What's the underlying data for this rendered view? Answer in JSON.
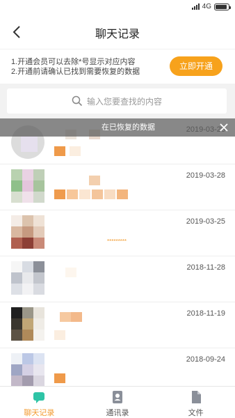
{
  "status_bar": {
    "network": "4G",
    "battery_level": 0.9
  },
  "header": {
    "title": "聊天记录",
    "back_icon": "chevron-left-icon"
  },
  "notice": {
    "line1": "1.开通会员可以去除*号显示对应内容",
    "line2": "2.开通前请确认已找到需要恢复的数据",
    "vip_button": "立即开通"
  },
  "search": {
    "placeholder": "输入您要查找的内容",
    "icon": "search-icon"
  },
  "toast": {
    "text": "在已恢复的数据",
    "close_icon": "close-icon"
  },
  "colors": {
    "accent": "#f7a21c",
    "masked_text": "#f29b2f"
  },
  "chats": [
    {
      "date": "2019-03-28",
      "masked": ""
    },
    {
      "date": "2019-03-28",
      "masked": ""
    },
    {
      "date": "2019-03-25",
      "masked": "*********"
    },
    {
      "date": "2018-11-28",
      "masked": ""
    },
    {
      "date": "2018-11-19",
      "masked": ""
    },
    {
      "date": "2018-09-24",
      "masked": ""
    }
  ],
  "tabs": [
    {
      "label": "聊天记录",
      "icon": "chat-icon",
      "active": true
    },
    {
      "label": "通讯录",
      "icon": "contacts-icon",
      "active": false
    },
    {
      "label": "文件",
      "icon": "file-icon",
      "active": false
    }
  ]
}
